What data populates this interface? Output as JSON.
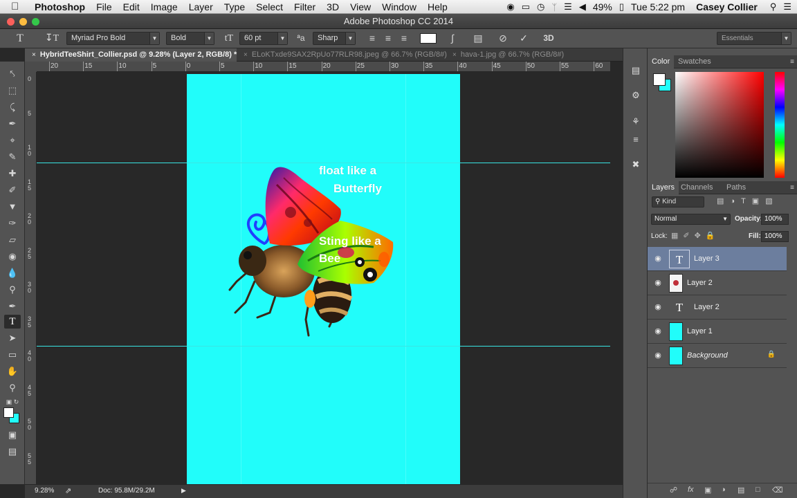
{
  "menubar": {
    "apple": "",
    "items": [
      "Photoshop",
      "File",
      "Edit",
      "Image",
      "Layer",
      "Type",
      "Select",
      "Filter",
      "3D",
      "View",
      "Window",
      "Help"
    ],
    "battery": "49%",
    "clock": "Tue 5:22 pm",
    "user": "Casey Collier"
  },
  "window": {
    "title": "Adobe Photoshop CC 2014",
    "traffic_colors": [
      "#fc605b",
      "#fdbc40",
      "#34c84a"
    ]
  },
  "options": {
    "font_family": "Myriad Pro Bold",
    "font_style": "Bold",
    "font_size": "60 pt",
    "anti_alias": "Sharp",
    "text_color": "#ffffff",
    "workspace": "Essentials",
    "icons": [
      "type-tool-icon",
      "toggle-orientation-icon",
      "font-size-icon",
      "anti-alias-icon",
      "align-left-icon",
      "align-center-icon",
      "align-right-icon",
      "warp-text-icon",
      "character-panel-icon",
      "cancel-icon",
      "commit-icon",
      "3d-icon"
    ]
  },
  "tabs": [
    {
      "label": "HybridTeeShirt_Collier.psd @ 9.28% (Layer 2, RGB/8) *",
      "active": true
    },
    {
      "label": "ELoKTxde9SAX2RpUo77RLR98.jpeg @ 66.7% (RGB/8#)",
      "active": false
    },
    {
      "label": "hava-1.jpg @ 66.7% (RGB/8#)",
      "active": false
    }
  ],
  "ruler": {
    "top_labels": [
      "20",
      "15",
      "10",
      "5",
      "0",
      "5",
      "10",
      "15",
      "20",
      "25",
      "30",
      "35",
      "40",
      "45",
      "50",
      "55",
      "60"
    ],
    "left_labels": [
      "0",
      "5",
      "10",
      "15",
      "20",
      "25",
      "30",
      "35",
      "40",
      "45",
      "50",
      "55"
    ]
  },
  "artwork": {
    "background_color": "#21fdfa",
    "text_line1": "float like a",
    "text_line2": "Butterfly",
    "text_line3": "Sting like a",
    "text_line4": "Bee"
  },
  "status": {
    "zoom": "9.28%",
    "doc": "Doc: 95.8M/29.2M"
  },
  "color_panel": {
    "tabs": [
      "Color",
      "Swatches"
    ],
    "foreground": "#ffffff",
    "background": "#21fdfa"
  },
  "layers_panel": {
    "tabs": [
      "Layers",
      "Channels",
      "Paths"
    ],
    "filter_kind": "Kind",
    "blend_mode": "Normal",
    "opacity_label": "Opacity:",
    "opacity": "100%",
    "lock_label": "Lock:",
    "fill_label": "Fill:",
    "fill": "100%",
    "layers": [
      {
        "name": "Layer 3",
        "type": "text",
        "selected": true
      },
      {
        "name": "Layer 2",
        "type": "image",
        "selected": false
      },
      {
        "name": "Layer 2",
        "type": "text",
        "selected": false
      },
      {
        "name": "Layer 1",
        "type": "fill",
        "selected": false
      },
      {
        "name": "Background",
        "type": "background",
        "selected": false
      }
    ]
  }
}
